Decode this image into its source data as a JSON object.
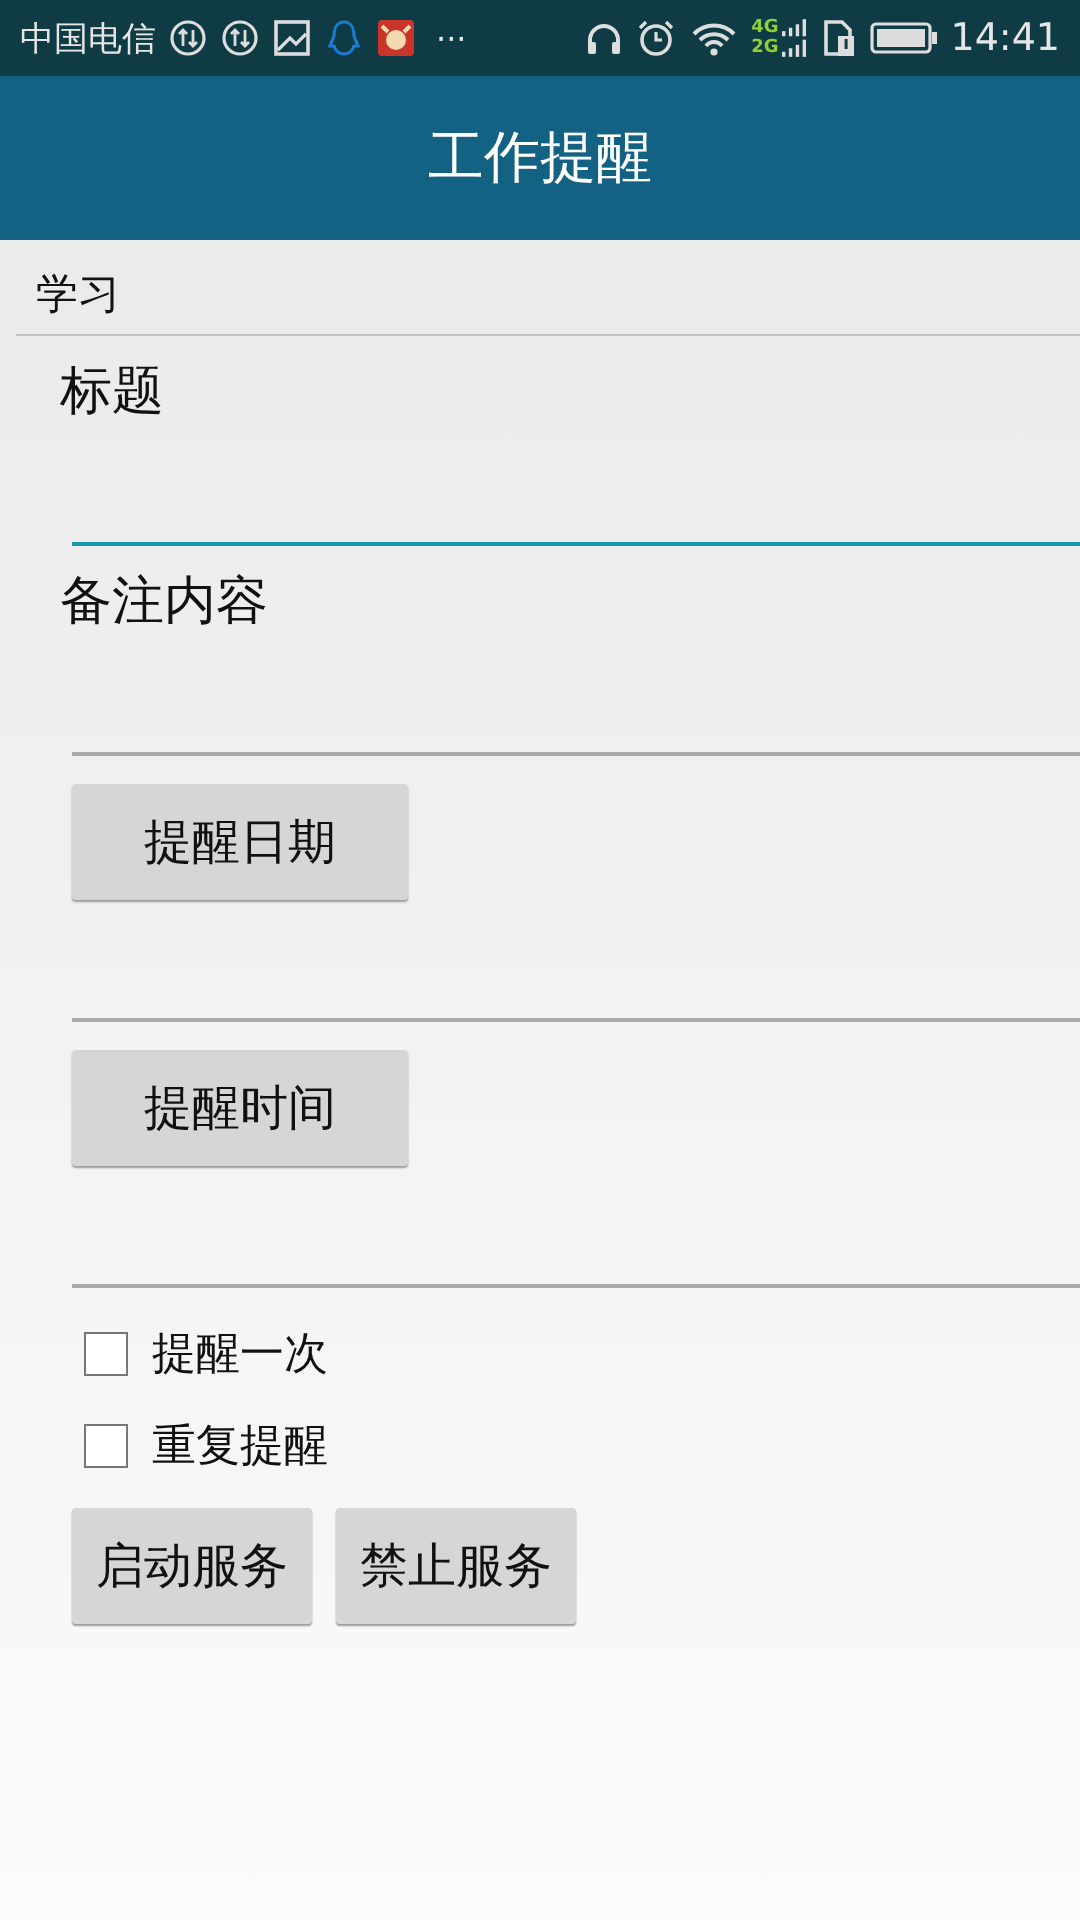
{
  "status_bar": {
    "carrier": "中国电信",
    "more": "···",
    "net_labels": [
      "4G",
      "2G"
    ],
    "time": "14:41"
  },
  "app_bar": {
    "title": "工作提醒"
  },
  "spinner": {
    "value": "学习"
  },
  "form": [
    {
      "kind": "label",
      "text": "标题"
    },
    {
      "kind": "field",
      "focused": true
    },
    {
      "kind": "label",
      "text": "备注内容"
    },
    {
      "kind": "field",
      "focused": false
    },
    {
      "kind": "button",
      "text": "提醒日期"
    },
    {
      "kind": "field",
      "focused": false
    },
    {
      "kind": "button",
      "text": "提醒时间"
    },
    {
      "kind": "field",
      "focused": false
    }
  ],
  "checkboxes": [
    {
      "label": "提醒一次",
      "checked": false
    },
    {
      "label": "重复提醒",
      "checked": false
    }
  ],
  "buttons": [
    "启动服务",
    "禁止服务"
  ]
}
